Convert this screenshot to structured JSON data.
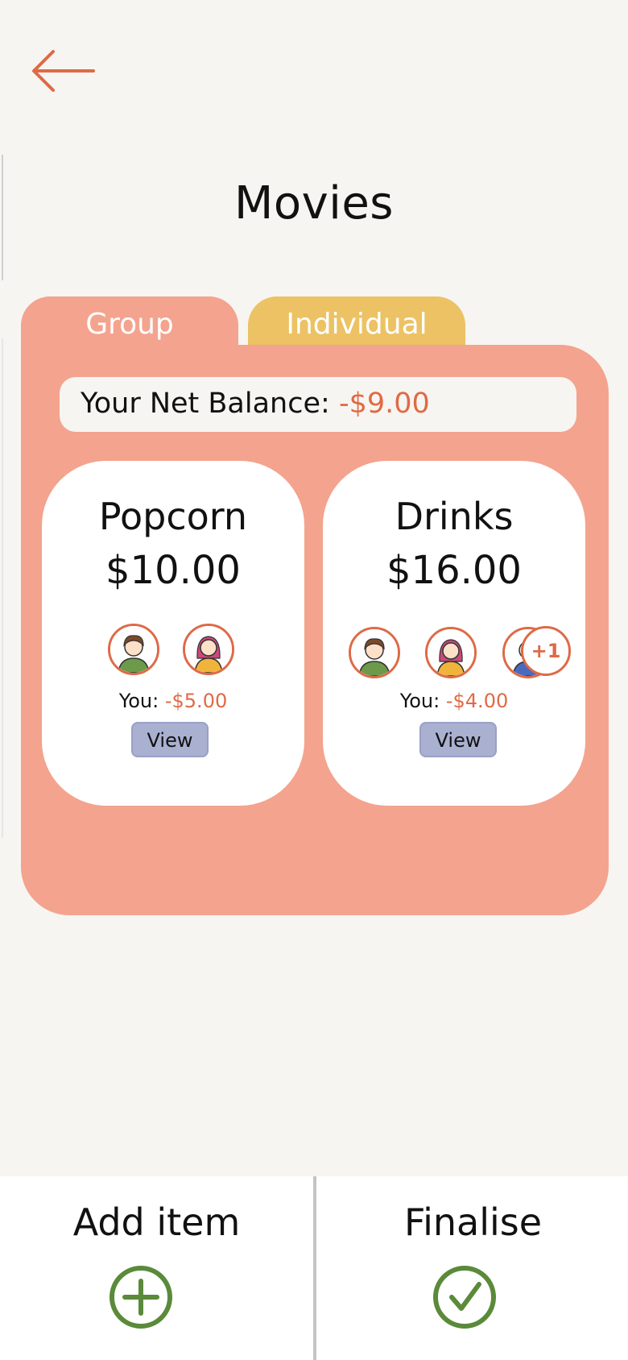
{
  "header": {
    "title": "Movies"
  },
  "tabs": [
    {
      "label": "Group"
    },
    {
      "label": "Individual"
    }
  ],
  "balance": {
    "label": "Your Net Balance:",
    "value": "-$9.00"
  },
  "items": [
    {
      "name": "Popcorn",
      "price": "$10.00",
      "you_label": "You:",
      "you_value": "-$5.00",
      "view_label": "View"
    },
    {
      "name": "Drinks",
      "price": "$16.00",
      "you_label": "You:",
      "you_value": "-$4.00",
      "view_label": "View",
      "extra_members": "+1"
    }
  ],
  "actions": {
    "add_label": "Add item",
    "finalise_label": "Finalise"
  },
  "colors": {
    "accent": "#e06a44",
    "panel": "#f4a38e",
    "tab_inactive": "#ecc264",
    "button": "#aab0d0",
    "success": "#5a8a3a"
  }
}
